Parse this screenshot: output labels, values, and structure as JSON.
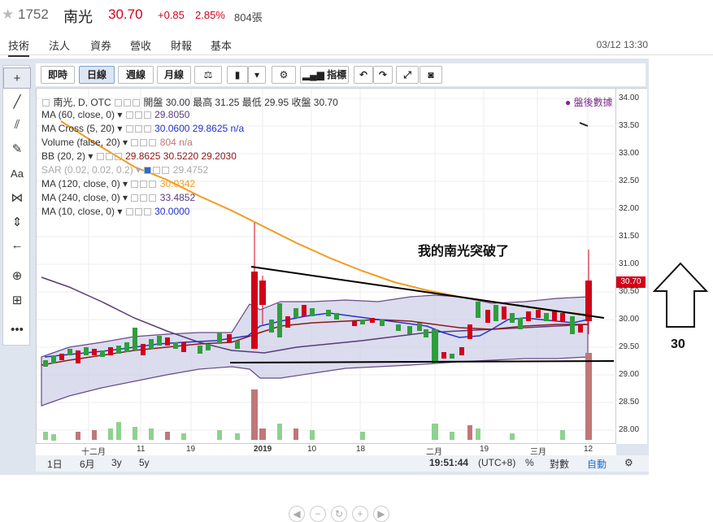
{
  "header": {
    "star": "★",
    "code": "1752",
    "name": "南光",
    "price": "30.70",
    "change": "+0.85",
    "pct": "2.85%",
    "volume": "804張"
  },
  "tabs": [
    "技術",
    "法人",
    "資券",
    "營收",
    "財報",
    "基本"
  ],
  "datetime": "03/12 13:30",
  "toolbar": {
    "b1": "即時",
    "b2": "日線",
    "b3": "週線",
    "b4": "月線",
    "b5": "指標"
  },
  "legend": {
    "l0": "南光, D, OTC",
    "l0v": "開盤 30.00 最高 31.25 最低 29.95 收盤 30.70",
    "l1": "MA (60, close, 0)",
    "l1v": "29.8050",
    "l2": "MA Cross (5, 20)",
    "l2v": "30.0600 29.8625 n/a",
    "l3": "Volume (false, 20)",
    "l3v": "804 n/a",
    "l4": "BB (20, 2)",
    "l4v": "29.8625 30.5220 29.2030",
    "l5": "SAR (0.02, 0.02, 0.2)",
    "l5v": "29.4752",
    "l6": "MA (120, close, 0)",
    "l6v": "30.0342",
    "l7": "MA (240, close, 0)",
    "l7v": "33.4852",
    "l8": "MA (10, close, 0)",
    "l8v": "30.0000"
  },
  "after_hours": "● 盤後數據",
  "yticks": [
    "34.00",
    "33.50",
    "33.00",
    "32.50",
    "32.00",
    "31.50",
    "31.00",
    "30.50",
    "30.00",
    "29.50",
    "29.00",
    "28.50",
    "28.00"
  ],
  "current_label": "30.70",
  "xticks": [
    "十二月",
    "11",
    "19",
    "2019",
    "10",
    "18",
    "二月",
    "19",
    "三月",
    "12"
  ],
  "bottom": {
    "r1": "1日",
    "r2": "6月",
    "r3": "3y",
    "r4": "5y",
    "time": "19:51:44",
    "tz": "(UTC+8)",
    "pct": "%",
    "log": "對數",
    "auto": "自動"
  },
  "annotation": "我的南光突破了",
  "arrow_label": "30",
  "colors": {
    "up": "#d0021b",
    "down": "#2e9e3c",
    "ma120": "#f39a1e",
    "ma60": "#8b1a1a",
    "ma10": "#2233cc",
    "ma240": "#5a3a7a",
    "bb_fill": "#cfd0e8"
  }
}
